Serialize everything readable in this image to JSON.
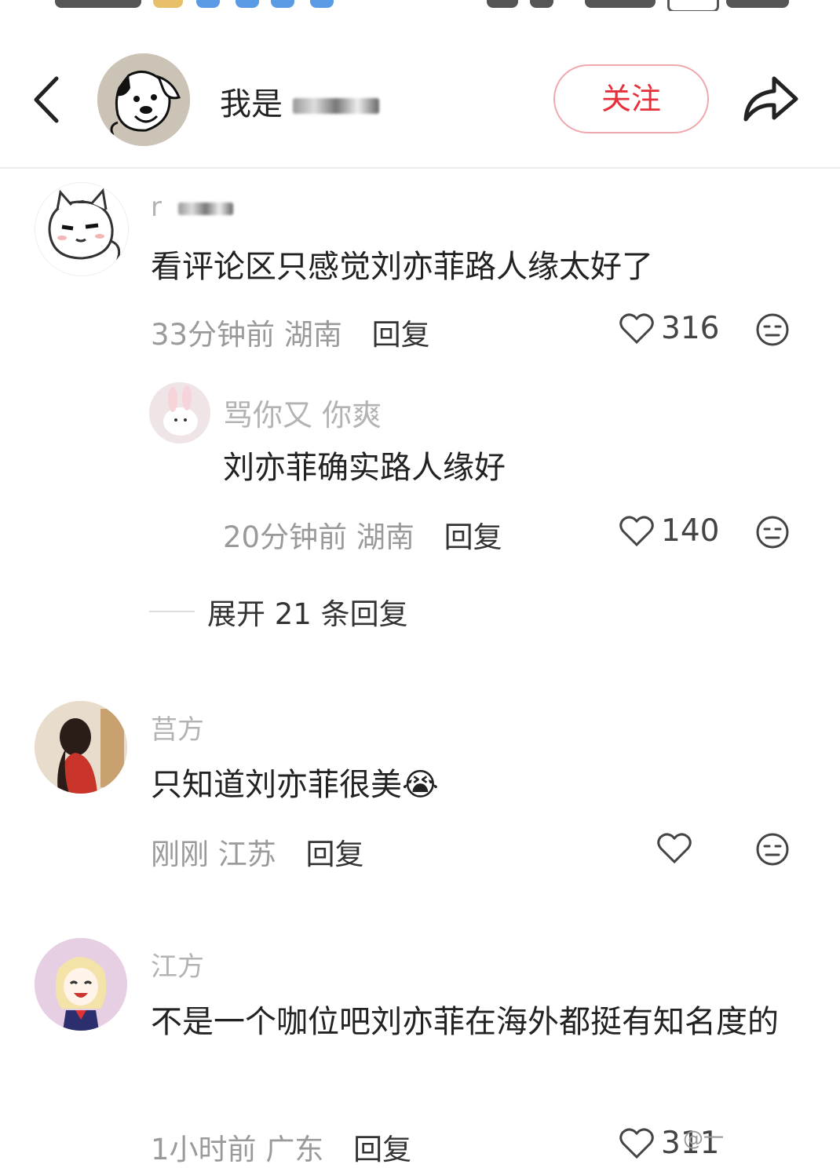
{
  "header": {
    "title_prefix": "我是",
    "follow_label": "关注"
  },
  "comments": [
    {
      "username": "r",
      "text": "看评论区只感觉刘亦菲路人缘太好了",
      "time": "33分钟前",
      "location": "湖南",
      "reply_label": "回复",
      "likes": "316"
    },
    {
      "username": "莒方",
      "text": "只知道刘亦菲很美😭",
      "time": "刚刚",
      "location": "江苏",
      "reply_label": "回复",
      "likes": ""
    },
    {
      "username": "江方",
      "text": "不是一个咖位吧刘亦菲在海外都挺有知名度的",
      "time": "1小时前",
      "location": "广东",
      "reply_label": "回复",
      "likes": "311"
    }
  ],
  "sub_reply": {
    "username": "骂你又 你爽",
    "text": "刘亦菲确实路人缘好",
    "time": "20分钟前",
    "location": "湖南",
    "reply_label": "回复",
    "likes": "140"
  },
  "expand_label": "展开 21 条回复",
  "watermark": "@一"
}
